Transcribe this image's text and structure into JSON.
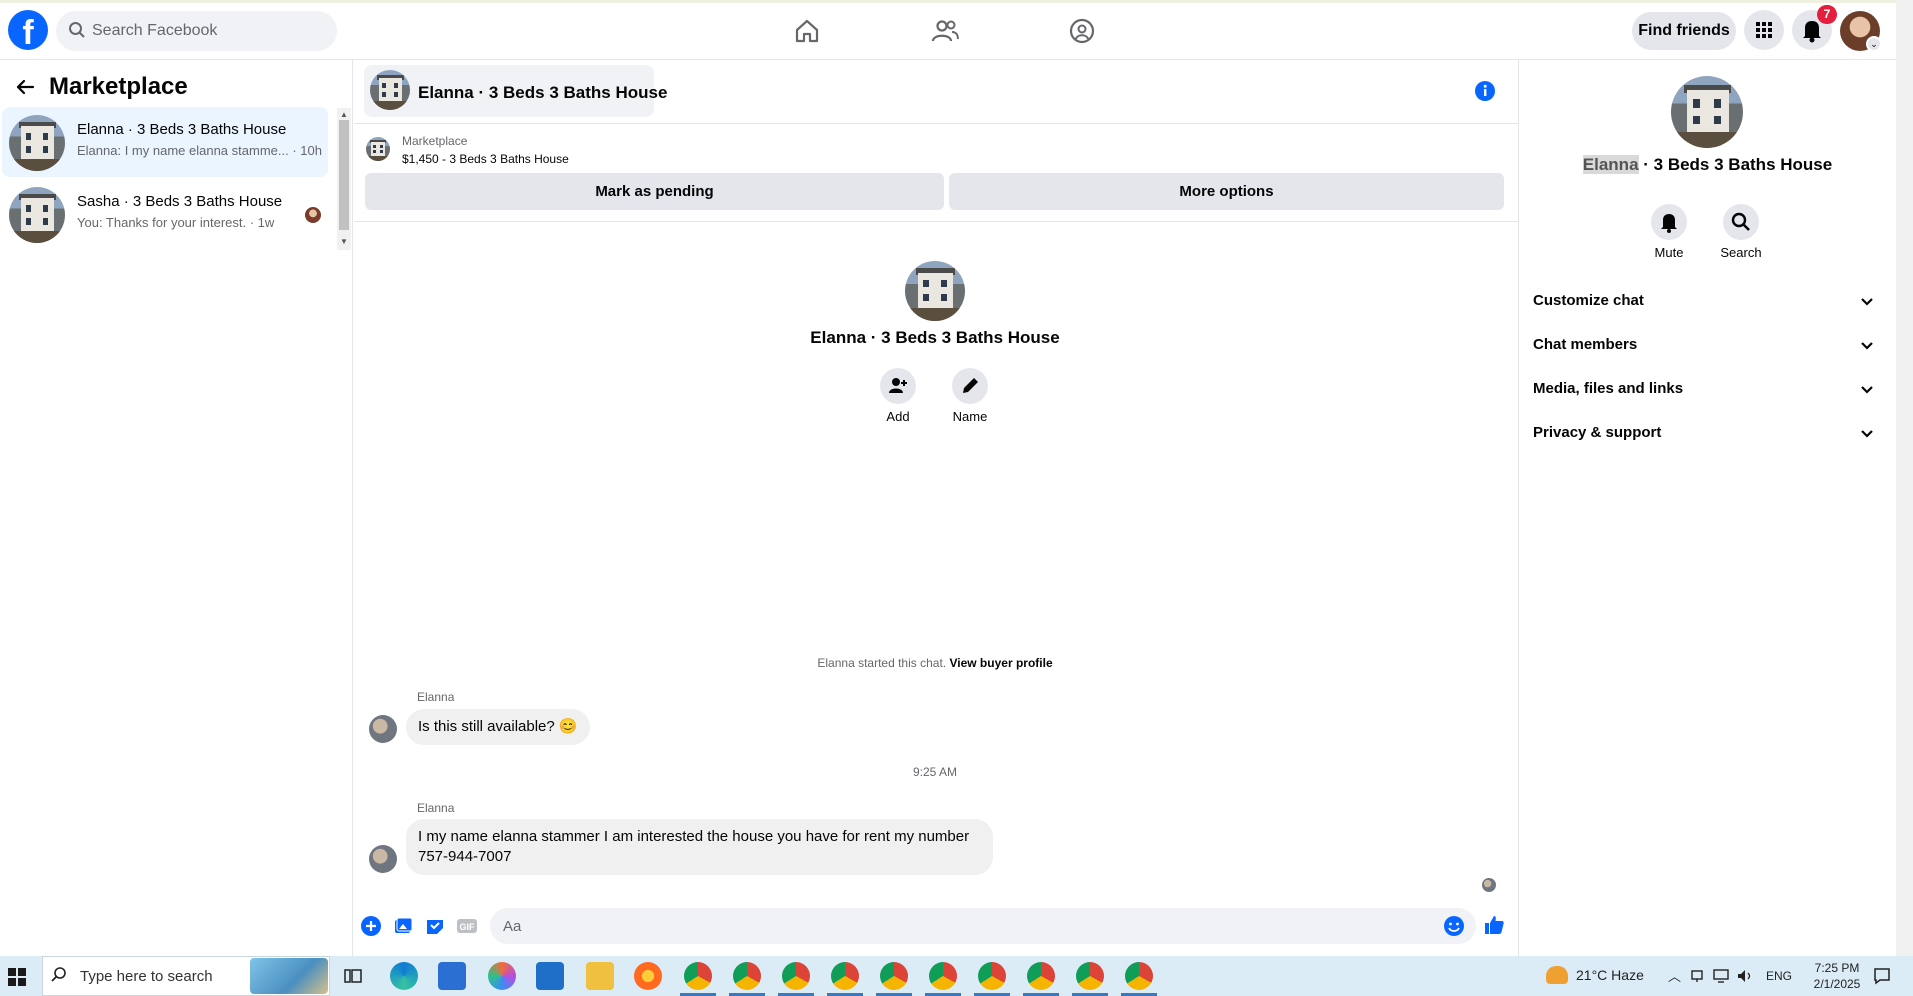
{
  "topbar": {
    "search_placeholder": "Search Facebook",
    "find_friends": "Find friends",
    "notif_count": "7"
  },
  "left": {
    "title": "Marketplace",
    "conversations": [
      {
        "name": "Elanna · 3 Beds 3 Baths House",
        "snippet": "Elanna: I my name elanna stamme... · 10h",
        "active": true
      },
      {
        "name": "Sasha · 3 Beds 3 Baths House",
        "snippet": "You: Thanks for your interest. · 1w",
        "active": false
      }
    ]
  },
  "chat": {
    "title": "Elanna · 3 Beds 3 Baths House",
    "listing_source": "Marketplace",
    "listing_price": "$1,450 - 3 Beds 3 Baths House",
    "mark_pending": "Mark as pending",
    "more_options": "More options",
    "intro_title": "Elanna · 3 Beds 3 Baths House",
    "intro_add": "Add",
    "intro_name": "Name",
    "started_text": "Elanna started this chat.",
    "view_buyer": "View buyer profile",
    "messages": [
      {
        "sender": "Elanna",
        "text": "Is this still available? 😊"
      },
      {
        "sender": "Elanna",
        "text": "I my name elanna stammer I am interested the house you have for rent my number 757-944-7007"
      }
    ],
    "time_separator": "9:25 AM",
    "composer_placeholder": "Aa"
  },
  "right": {
    "title_name": "Elanna",
    "title_rest": " · 3 Beds 3 Baths House",
    "mute": "Mute",
    "search": "Search",
    "sections": [
      "Customize chat",
      "Chat members",
      "Media, files and links",
      "Privacy & support"
    ]
  },
  "taskbar": {
    "search_placeholder": "Type here to search",
    "weather": "21°C  Haze",
    "lang": "ENG",
    "time": "7:25 PM",
    "date": "2/1/2025"
  },
  "colors": {
    "brand": "#0866ff",
    "badge": "#e41e3f",
    "active_conv": "#ebf5ff"
  }
}
